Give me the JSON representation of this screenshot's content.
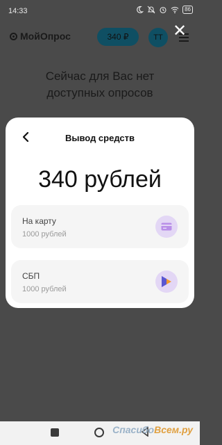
{
  "status_bar": {
    "time": "14:33",
    "battery": "86",
    "icons": [
      "moon-icon",
      "mute-icon",
      "alarm-icon",
      "wifi-icon",
      "battery-icon"
    ]
  },
  "header": {
    "brand": "МойОпрос",
    "balance": "340 ₽",
    "avatar_initials": "ТТ"
  },
  "background": {
    "message": "Сейчас для Вас нет доступных опросов"
  },
  "modal": {
    "title": "Вывод средств",
    "amount": "340 рублей",
    "options": [
      {
        "name": "На карту",
        "limit": "1000 рублей",
        "icon": "card-icon"
      },
      {
        "name": "СБП",
        "limit": "1000 рублей",
        "icon": "sbp-icon"
      }
    ]
  },
  "watermark": {
    "text_a": "Спасибо",
    "text_b": "Всем.ру"
  },
  "colors": {
    "accent": "#0f4f63",
    "option_icon_bg": "#e3d7f5",
    "overlay": "#4a4a4a"
  }
}
